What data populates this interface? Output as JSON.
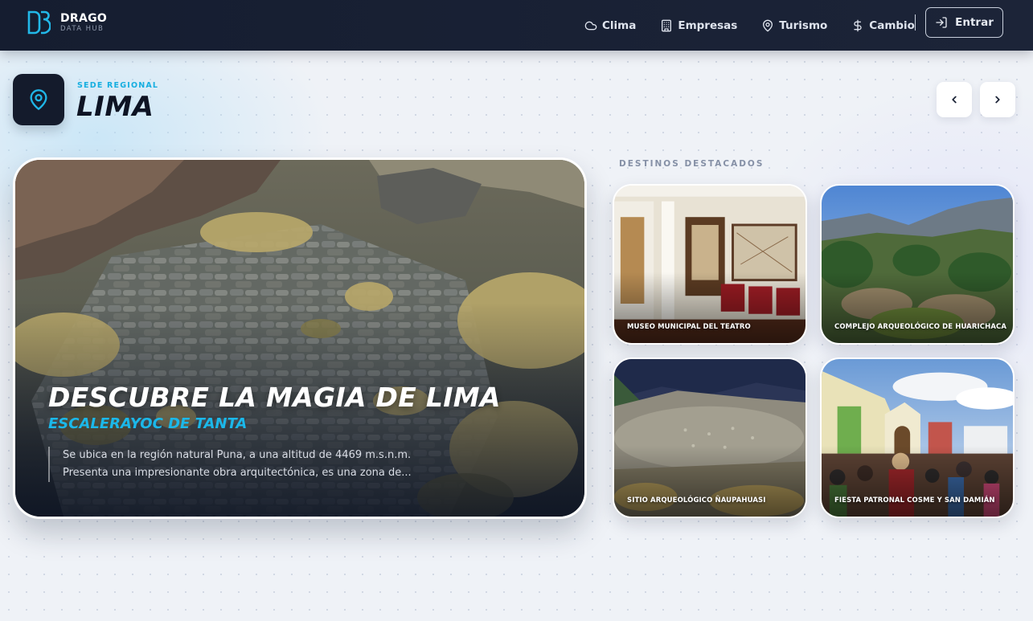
{
  "nav": {
    "brand_name": "DRAGO",
    "brand_tag": "DATA HUB",
    "links": [
      {
        "label": "Clima",
        "icon": "cloud-icon"
      },
      {
        "label": "Empresas",
        "icon": "building-icon"
      },
      {
        "label": "Turismo",
        "icon": "map-pin-icon"
      },
      {
        "label": "Cambio",
        "icon": "dollar-icon"
      }
    ],
    "login_label": "Entrar"
  },
  "header": {
    "kicker": "SEDE REGIONAL",
    "region": "LIMA"
  },
  "hero": {
    "title": "DESCUBRE LA MAGIA DE LIMA",
    "subtitle": "ESCALERAYOC DE TANTA",
    "desc_line1": "Se ubica en la región natural Puna, a una altitud de 4469 m.s.n.m.",
    "desc_line2": "Presenta una impresionante obra arquitectónica, es una zona de..."
  },
  "destinations": {
    "label": "DESTINOS DESTACADOS",
    "items": [
      {
        "name": "MUSEO MUNICIPAL DEL TEATRO"
      },
      {
        "name": "COMPLEJO ARQUEOLÓGICO DE HUARICHACA"
      },
      {
        "name": "SITIO ARQUEOLÓGICO ÑAUPAHUASI"
      },
      {
        "name": "FIESTA PATRONAL COSME Y SAN DAMIÁN"
      }
    ]
  },
  "colors": {
    "accent": "#16aee0",
    "nav_bg": "#151d30",
    "title_dark": "#0e1424"
  }
}
